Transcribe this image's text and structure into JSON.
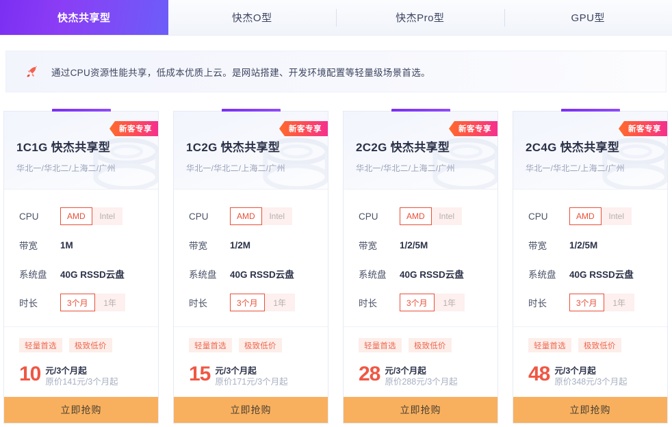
{
  "tabs": [
    {
      "label": "快杰共享型",
      "active": true
    },
    {
      "label": "快杰O型",
      "active": false
    },
    {
      "label": "快杰Pro型",
      "active": false
    },
    {
      "label": "GPU型",
      "active": false
    }
  ],
  "banner": {
    "icon": "rocket-icon",
    "text": "通过CPU资源性能共享，低成本优质上云。是网站搭建、开发环境配置等轻量级场景首选。"
  },
  "labels": {
    "cpu": "CPU",
    "bandwidth": "带宽",
    "disk": "系统盘",
    "duration": "时长",
    "buy": "立即抢购",
    "ribbon": "新客专享",
    "tag_light": "轻量首选",
    "tag_cheap": "极致低价",
    "unit": "元/3个月起",
    "cpu_amd": "AMD",
    "cpu_intel": "Intel",
    "dur_3m": "3个月",
    "dur_1y": "1年"
  },
  "colors": {
    "accent_purple": "#7b2ff2",
    "ribbon_start": "#ff6a2b",
    "ribbon_end": "#f5308f",
    "price_red": "#ef5744",
    "buy_orange": "#f8b05f",
    "tag_bg": "#fdeeea"
  },
  "cards": [
    {
      "title": "1C1G 快杰共享型",
      "region": "华北一/华北二/上海二/广州",
      "bandwidth": "1M",
      "disk": "40G RSSD云盘",
      "price": "10",
      "original": "原价141元/3个月起"
    },
    {
      "title": "1C2G 快杰共享型",
      "region": "华北一/华北二/上海二/广州",
      "bandwidth": "1/2M",
      "disk": "40G RSSD云盘",
      "price": "15",
      "original": "原价171元/3个月起"
    },
    {
      "title": "2C2G 快杰共享型",
      "region": "华北一/华北二/上海二/广州",
      "bandwidth": "1/2/5M",
      "disk": "40G RSSD云盘",
      "price": "28",
      "original": "原价288元/3个月起"
    },
    {
      "title": "2C4G 快杰共享型",
      "region": "华北一/华北二/上海二/广州",
      "bandwidth": "1/2/5M",
      "disk": "40G RSSD云盘",
      "price": "48",
      "original": "原价348元/3个月起"
    }
  ]
}
